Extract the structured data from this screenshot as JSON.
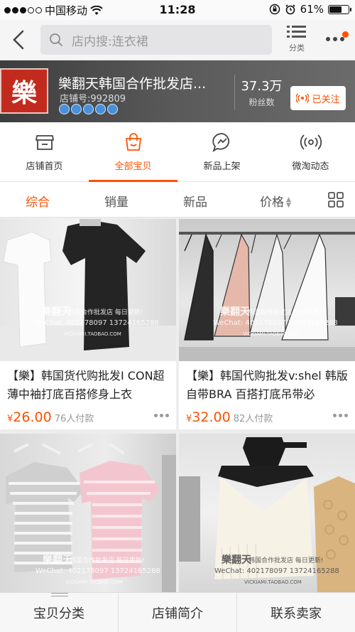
{
  "status_bar": {
    "carrier": "中国移动",
    "time": "11:28",
    "battery": "61%"
  },
  "nav": {
    "search_placeholder": "店内搜:连衣裙",
    "category_label": "分类"
  },
  "shop": {
    "logo_char": "樂",
    "name": "樂翻天韩国合作批发店...",
    "shop_id": "店铺号:992809",
    "crown_count": 5,
    "fans_count": "37.3万",
    "fans_label": "粉丝数",
    "follow_label": "已关注"
  },
  "tabs": [
    {
      "label": "店铺首页",
      "icon": "store-icon",
      "active": false
    },
    {
      "label": "全部宝贝",
      "icon": "bag-icon",
      "active": true
    },
    {
      "label": "新品上架",
      "icon": "chat-bubble-icon",
      "active": false
    },
    {
      "label": "微淘动态",
      "icon": "broadcast-icon",
      "active": false
    }
  ],
  "sort": {
    "comprehensive": "综合",
    "sales": "销量",
    "new": "新品",
    "price": "价格"
  },
  "products": [
    {
      "title": "【樂】韩国货代购批发I CON超薄中袖打底百搭修身上衣",
      "price_symbol": "¥",
      "price": "26.00",
      "sales": "76人付款"
    },
    {
      "title": "【樂】韩国代购批发v:shel 韩版 自带BRA 百搭打底吊带必",
      "price_symbol": "¥",
      "price": "32.00",
      "sales": "82人付款"
    }
  ],
  "watermark": {
    "brand": "樂翻天",
    "tag": "韩国合作批发店 每日更新!",
    "wechat": "WeChat: 402178097 13724165288",
    "url": "VICKIAMI.TAOBAO.COM"
  },
  "bottom_bar": {
    "categories": "宝贝分类",
    "intro": "店铺简介",
    "contact": "联系卖家"
  },
  "colors": {
    "accent": "#ff5000",
    "banner": "#4a4a4a"
  }
}
